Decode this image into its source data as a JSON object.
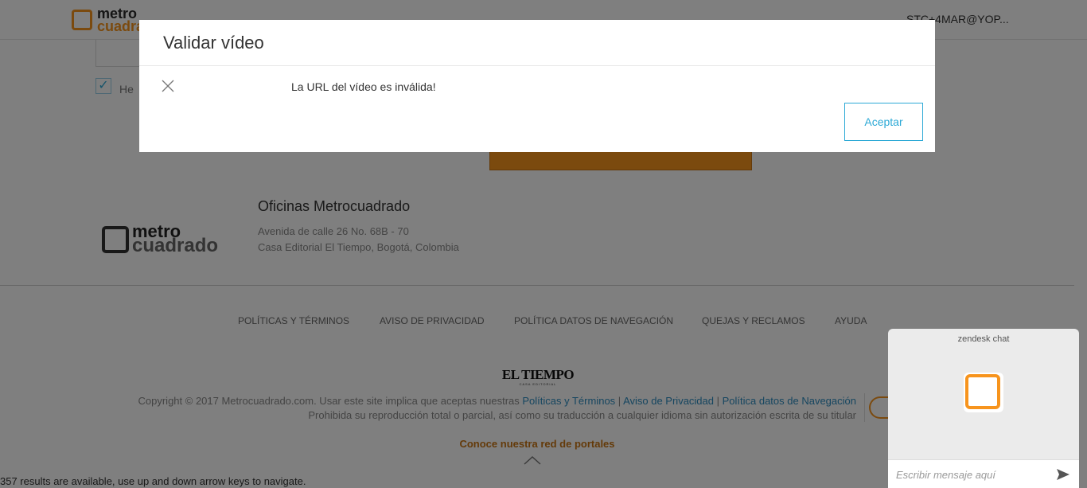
{
  "header": {
    "logo_line1": "metro",
    "logo_line2": "cuadrado",
    "user_email": "STC+4MAR@YOP..."
  },
  "form": {
    "terms_check_mark": "✓",
    "terms_label": "He"
  },
  "footer": {
    "logo_line1": "metro",
    "logo_line2": "cuadrado",
    "offices_title": "Oficinas Metrocuadrado",
    "address_line1": "Avenida de calle 26 No. 68B - 70",
    "address_line2": "Casa Editorial El Tiempo, Bogotá, Colombia",
    "links": [
      "POLÍTICAS Y TÉRMINOS",
      "AVISO DE PRIVACIDAD",
      "POLÍTICA DATOS DE NAVEGACIÓN",
      "QUEJAS Y RECLAMOS",
      "AYUDA"
    ],
    "eltiempo_logo": "EL TIEMPO",
    "eltiempo_sub": "CASA EDITORIAL",
    "copyright_prefix": "Copyright © 2017 Metrocuadrado.com. Usar este site implica que aceptas nuestras ",
    "copyright_link1": "Políticas y Términos",
    "sep": " | ",
    "copyright_link2": "Aviso de Privacidad",
    "copyright_link3": "Política datos de Navegación",
    "copyright_line2": "Prohibida su reproducción total o parcial, así como su traducción a cualquier idioma sin autorización escrita de su titular",
    "portals_link": "Conoce nuestra red de portales"
  },
  "status_message": "357 results are available, use up and down arrow keys to navigate.",
  "modal": {
    "title": "Validar vídeo",
    "message": "La URL del vídeo es inválida!",
    "accept_label": "Aceptar"
  },
  "chat": {
    "header": "zendesk chat",
    "input_placeholder": "Escribir mensaje aquí"
  },
  "colors": {
    "brand_orange": "#f7941d",
    "accent_blue": "#2ca9d6",
    "overlay": "rgba(0,0,0,0.5)"
  }
}
